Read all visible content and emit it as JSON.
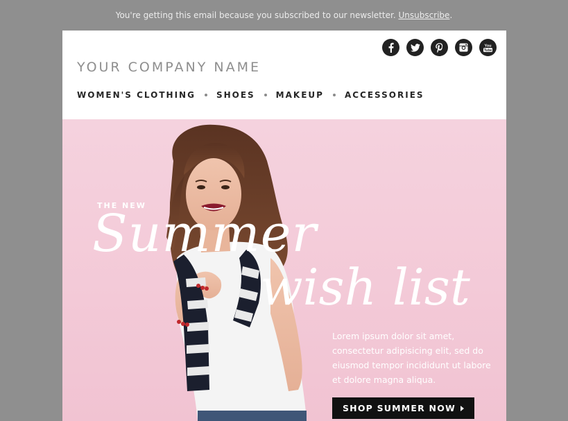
{
  "preheader": {
    "text": "You're getting this email because you subscribed to our newsletter. ",
    "unsubscribe_label": "Unsubscribe",
    "trailing": "."
  },
  "social": [
    {
      "name": "facebook-icon",
      "glyph": "f"
    },
    {
      "name": "twitter-icon",
      "glyph": "t"
    },
    {
      "name": "pinterest-icon",
      "glyph": "p"
    },
    {
      "name": "instagram-icon",
      "glyph": "ig"
    },
    {
      "name": "youtube-icon",
      "glyph": "You Tube"
    }
  ],
  "header": {
    "company_name": "YOUR COMPANY NAME",
    "nav": [
      "WOMEN'S CLOTHING",
      "SHOES",
      "MAKEUP",
      "ACCESSORIES"
    ]
  },
  "hero": {
    "kicker": "THE NEW",
    "headline_1": "Summer",
    "headline_2": "wish list",
    "body": "Lorem ipsum dolor sit amet, consectetur adipisicing elit, sed do eiusmod tempor incididunt ut labore et dolore magna aliqua.",
    "cta_label": "SHOP SUMMER NOW"
  },
  "colors": {
    "page_bg": "#8f8f8f",
    "hero_bg": "#f3c9d7",
    "cta_bg": "#111111",
    "social_bg": "#222222"
  }
}
